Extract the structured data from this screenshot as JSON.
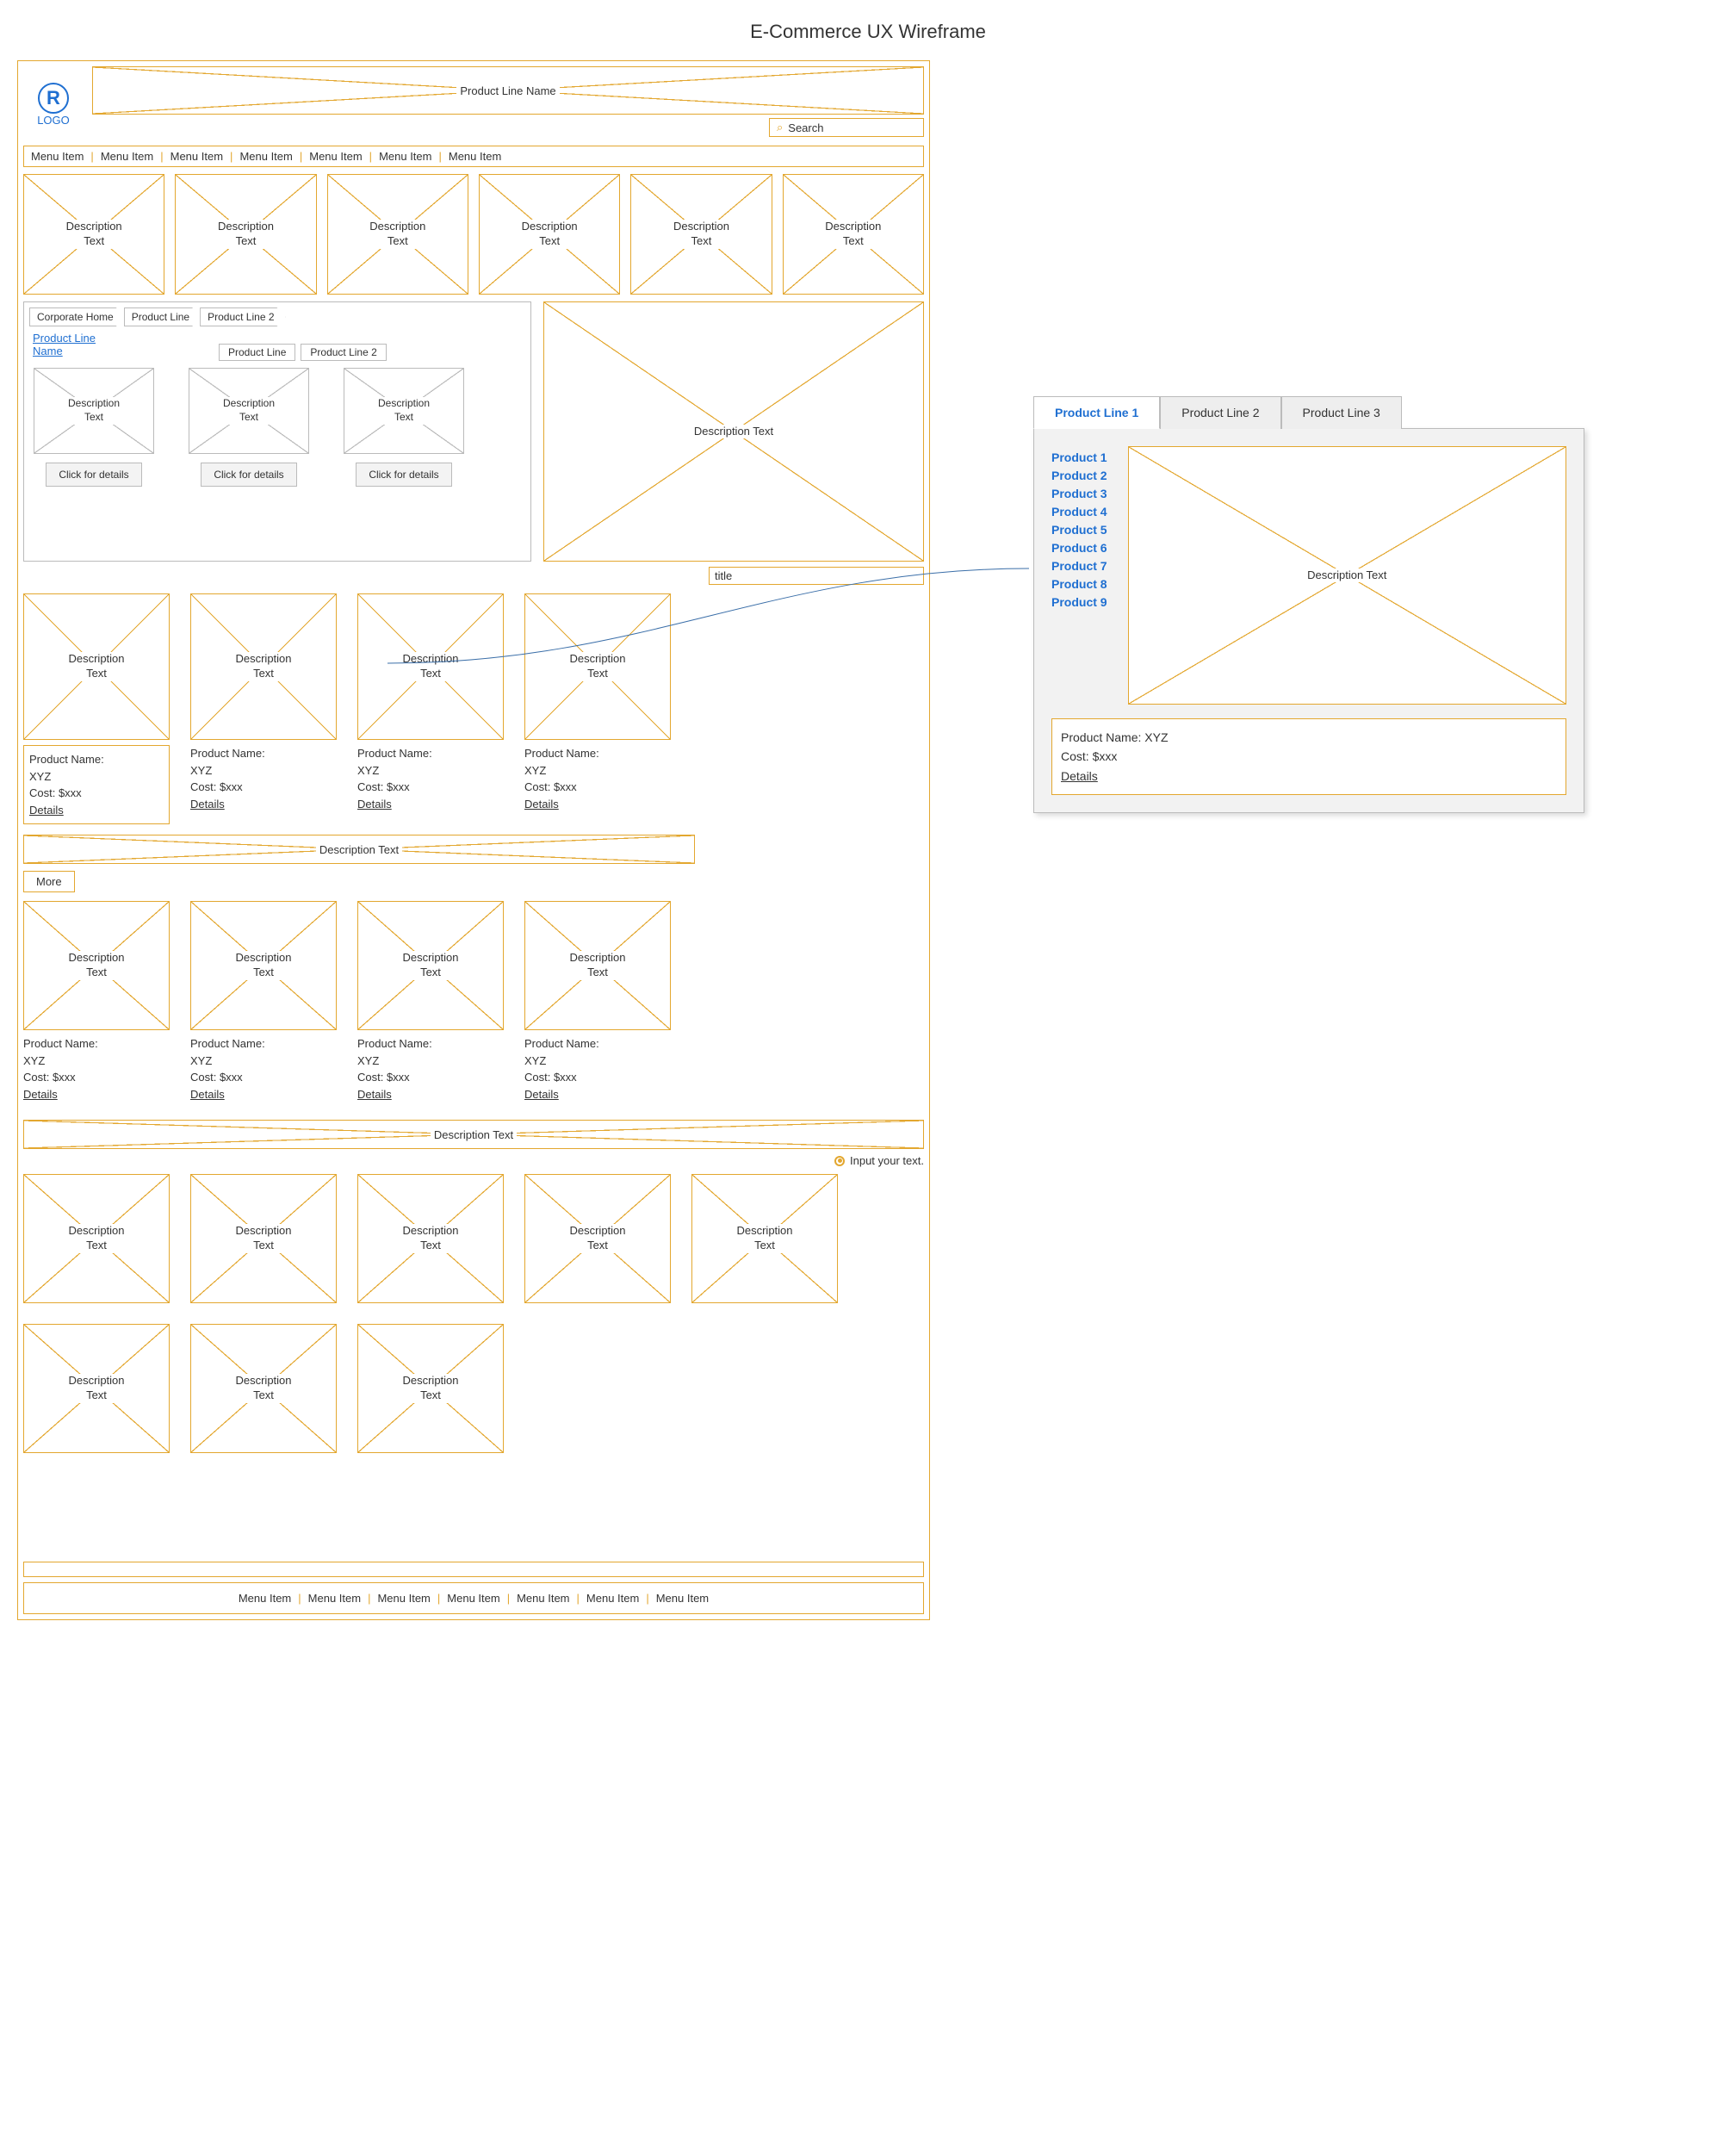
{
  "page_title": "E-Commerce UX Wireframe",
  "logo_text": "LOGO",
  "logo_symbol": "R",
  "banner_label": "Product Line Name",
  "search_placeholder": "Search",
  "menu_item": "Menu Item",
  "desc_text": "Description Text",
  "desc_text_2line": "Description\nText",
  "crumbs": {
    "c1": "Corporate Home",
    "c2": "Product Line",
    "c3": "Product Line 2"
  },
  "pl_link": "Product Line Name",
  "mini_tab1": "Product Line",
  "mini_tab2": "Product Line 2",
  "click_details": "Click for details",
  "title_field": "title",
  "product_name": "Product Name: XYZ",
  "product_name_2l": "Product Name:\nXYZ",
  "cost": "Cost: $xxx",
  "details": "Details",
  "more": "More",
  "radio_label": "Input your text.",
  "detail_tabs": {
    "t1": "Product Line 1",
    "t2": "Product Line 2",
    "t3": "Product Line  3"
  },
  "detail_products": {
    "p1": "Product 1",
    "p2": "Product 2",
    "p3": "Product 3",
    "p4": "Product 4",
    "p5": "Product 5",
    "p6": "Product 6",
    "p7": "Product 7",
    "p8": "Product 8",
    "p9": "Product 9"
  }
}
